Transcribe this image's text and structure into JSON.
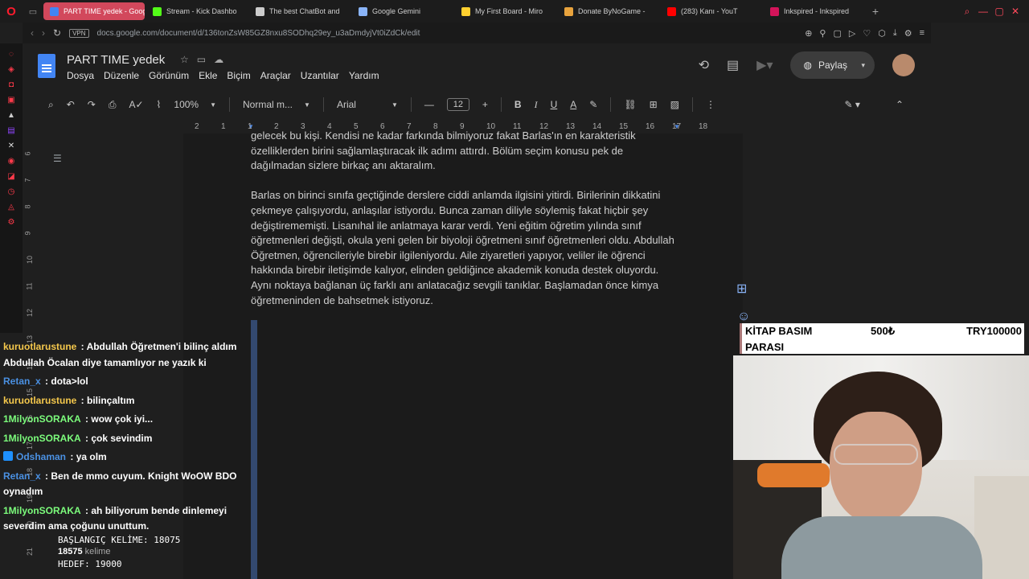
{
  "browser": {
    "tabs": [
      {
        "label": "PART TIME yedek - Goog",
        "active": true,
        "icon_color": "#4285f4"
      },
      {
        "label": "Stream - Kick Dashbo",
        "icon_color": "#53fc18"
      },
      {
        "label": "The best ChatBot and",
        "icon_color": "#cccccc"
      },
      {
        "label": "Google Gemini",
        "icon_color": "#8ab4f8"
      },
      {
        "label": "My First Board - Miro",
        "icon_color": "#ffd02f"
      },
      {
        "label": "Donate ByNoGame - ",
        "icon_color": "#e8a33d"
      },
      {
        "label": "(283) Kanı - YouT",
        "icon_color": "#ff0000"
      },
      {
        "label": "Inkspired - Inkspired",
        "icon_color": "#d4145a"
      }
    ],
    "url": "docs.google.com/document/d/136tonZsW85GZ8nxu8SODhq29ey_u3aDmdyjVt0iZdCk/edit",
    "vpn_label": "VPN"
  },
  "docs": {
    "title": "PART TIME yedek",
    "menu": [
      "Dosya",
      "Düzenle",
      "Görünüm",
      "Ekle",
      "Biçim",
      "Araçlar",
      "Uzantılar",
      "Yardım"
    ],
    "share_label": "Paylaş",
    "toolbar": {
      "zoom": "100%",
      "style": "Normal m...",
      "font": "Arial",
      "font_size": "12"
    },
    "ruler_ticks": [
      "2",
      "1",
      "1",
      "2",
      "3",
      "4",
      "5",
      "6",
      "7",
      "8",
      "9",
      "10",
      "11",
      "12",
      "13",
      "14",
      "15",
      "16",
      "17",
      "18"
    ],
    "vruler_ticks": [
      "6",
      "7",
      "8",
      "9",
      "10",
      "11",
      "12",
      "13",
      "14",
      "15",
      "16",
      "17",
      "18",
      "19",
      "20",
      "21"
    ],
    "paragraphs": [
      "gelecek bu kişi. Kendisi ne kadar farkında bilmiyoruz fakat Barlas'ın en karakteristik özelliklerden birini sağlamlaştıracak ilk adımı attırdı. Bölüm seçim konusu pek de dağılmadan sizlere birkaç anı aktaralım.",
      "Barlas on birinci sınıfa geçtiğinde derslere ciddi anlamda ilgisini yitirdi. Birilerinin dikkatini çekmeye çalışıyordu, anlaşılar istiyordu. Bunca zaman diliyle söylemiş fakat hiçbir şey değiştirememişti. Lisanıhal ile anlatmaya karar verdi. Yeni eğitim öğretim yılında sınıf öğretmenleri değişti, okula yeni gelen bir biyoloji öğretmeni sınıf öğretmenleri oldu. Abdullah Öğretmen, öğrencileriyle birebir ilgileniyordu. Aile ziyaretleri yapıyor, veliler ile öğrenci hakkında birebir iletişimde kalıyor, elinden geldiğince akademik konuda destek oluyordu. Aynı noktaya bağlanan üç farklı anı anlatacağız sevgili tanıklar. Başlamadan önce kimya öğretmeninden de bahsetmek istiyoruz."
    ]
  },
  "chat": [
    {
      "user": "kuruotlarustune",
      "color": "#f5c84c",
      "text": "Abdullah Öğretmen'i bilinç aldım Abdullah Öcalan diye tamamlıyor ne yazık ki"
    },
    {
      "user": "Retan_x",
      "color": "#4a90e2",
      "text": "dota>lol"
    },
    {
      "user": "kuruotlarustune",
      "color": "#f5c84c",
      "text": "bilinçaltım"
    },
    {
      "user": "1MilyonSORAKA",
      "color": "#7cfc7c",
      "text": "wow çok iyi..."
    },
    {
      "user": "1MilyonSORAKA",
      "color": "#7cfc7c",
      "text": "çok sevindim"
    },
    {
      "user": "Odshaman",
      "color": "#4a90e2",
      "text": "ya olm",
      "badge": true
    },
    {
      "user": "Retan_x",
      "color": "#4a90e2",
      "text": "Ben de mmo cuyum. Knight WoOW BDO oynadım"
    },
    {
      "user": "1MilyonSORAKA",
      "color": "#7cfc7c",
      "text": "ah biliyorum bende dinlemeyi severdim ama çoğunu unuttum."
    }
  ],
  "overlay": {
    "start_words": "BAŞLANGIÇ KELİME: 18075",
    "word_count_number": "18575",
    "word_count_label": "kelime",
    "target": "HEDEF: 19000",
    "donation_title_1": "KİTAP BASIM",
    "donation_title_2": "PARASI",
    "donation_amount": "500₺",
    "donation_goal": "TRY100000"
  }
}
